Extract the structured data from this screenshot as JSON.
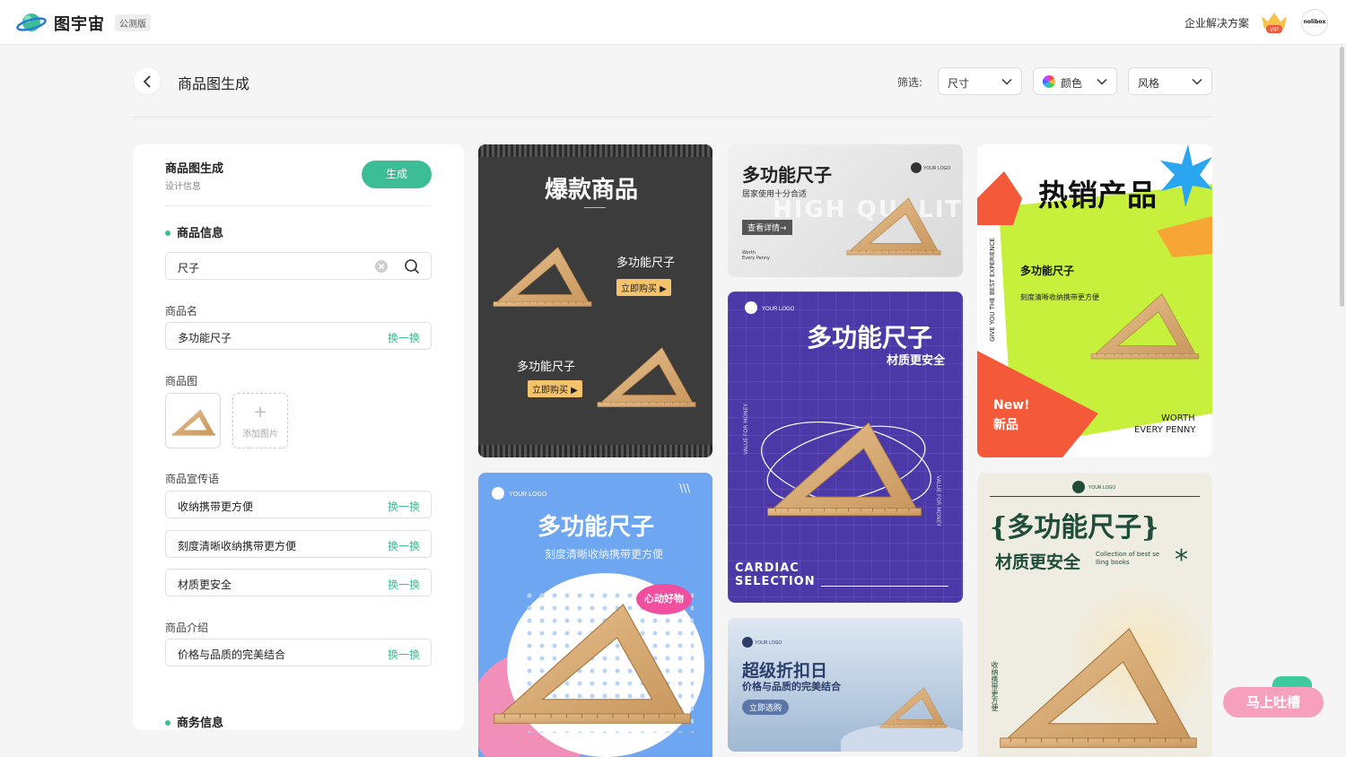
{
  "app": {
    "name": "图宇宙",
    "badge": "公测版",
    "enterprise_link": "企业解决方案",
    "vip_label": "VIP",
    "avatar_text": "nolibox"
  },
  "header": {
    "title": "商品图生成",
    "filter_label": "筛选:",
    "filters": [
      {
        "label": "尺寸"
      },
      {
        "label": "颜色"
      },
      {
        "label": "风格"
      }
    ]
  },
  "panel": {
    "title": "商品图生成",
    "subtitle": "设计信息",
    "generate_label": "生成",
    "product_info_title": "商品信息",
    "search_value": "尺子",
    "name_label": "商品名",
    "name_value": "多功能尺子",
    "swap_label": "换一换",
    "image_label": "商品图",
    "add_image_label": "添加图片",
    "slogan_label": "商品宣传语",
    "slogans": [
      "收纳携带更方便",
      "刻度清晰收纳携带更方便",
      "材质更安全"
    ],
    "intro_label": "商品介绍",
    "intro_value": "价格与品质的完美结合",
    "business_title": "商务信息"
  },
  "cards": {
    "c1": {
      "title": "爆款商品",
      "sub1": "多功能尺子",
      "btn1": "立即购买 ▶",
      "sub2": "多功能尺子",
      "btn2": "立即购买 ▶"
    },
    "c2": {
      "title": "多功能尺子",
      "sub": "刻度清晰收纳携带更方便",
      "logo": "YOUR LOGO",
      "badge": "心动好物"
    },
    "c3": {
      "title": "多功能尺子",
      "sub": "居家使用十分合适",
      "logo": "YOUR LOGO",
      "watermark": "HIGH QUALITY",
      "btn": "查看详情→",
      "foot1": "Worth",
      "foot2": "Every Penny"
    },
    "c4": {
      "logo": "YOUR LOGO",
      "title": "多功能尺子",
      "sub": "材质更安全",
      "side_left": "VALUE FOR MONEY",
      "side_right": "VALUE FOR MONEY",
      "foot1": "CARDIAC",
      "foot2": "SELECTION"
    },
    "c5": {
      "logo": "YOUR LOGO",
      "title": "超级折扣日",
      "sub": "价格与品质的完美结合",
      "btn": "立即选购"
    },
    "c6": {
      "title": "热销产品",
      "sub": "多功能尺子",
      "desc": "刻度清晰收纳携带更方便",
      "vertical": "GIVE YOU THE BEST EXPERIENCE",
      "new1": "New!",
      "new2": "新品",
      "worth1": "WORTH",
      "worth2": "EVERY PENNY"
    },
    "c7": {
      "logo": "YOUR LOGO",
      "title": "{多功能尺子}",
      "sub": "材质更安全",
      "en1": "Collection of best se",
      "en2": "lling books",
      "vertical": "收纳携带更方便"
    }
  },
  "float_button": "马上吐槽",
  "colors": {
    "accent": "#3dbd96",
    "c1_bg": "#3c3c3c",
    "c2_bg": "#6ea6f1",
    "c4_bg": "#4b39a8",
    "c6_bg": "#c6f03c",
    "c7_bg": "#efece2"
  }
}
